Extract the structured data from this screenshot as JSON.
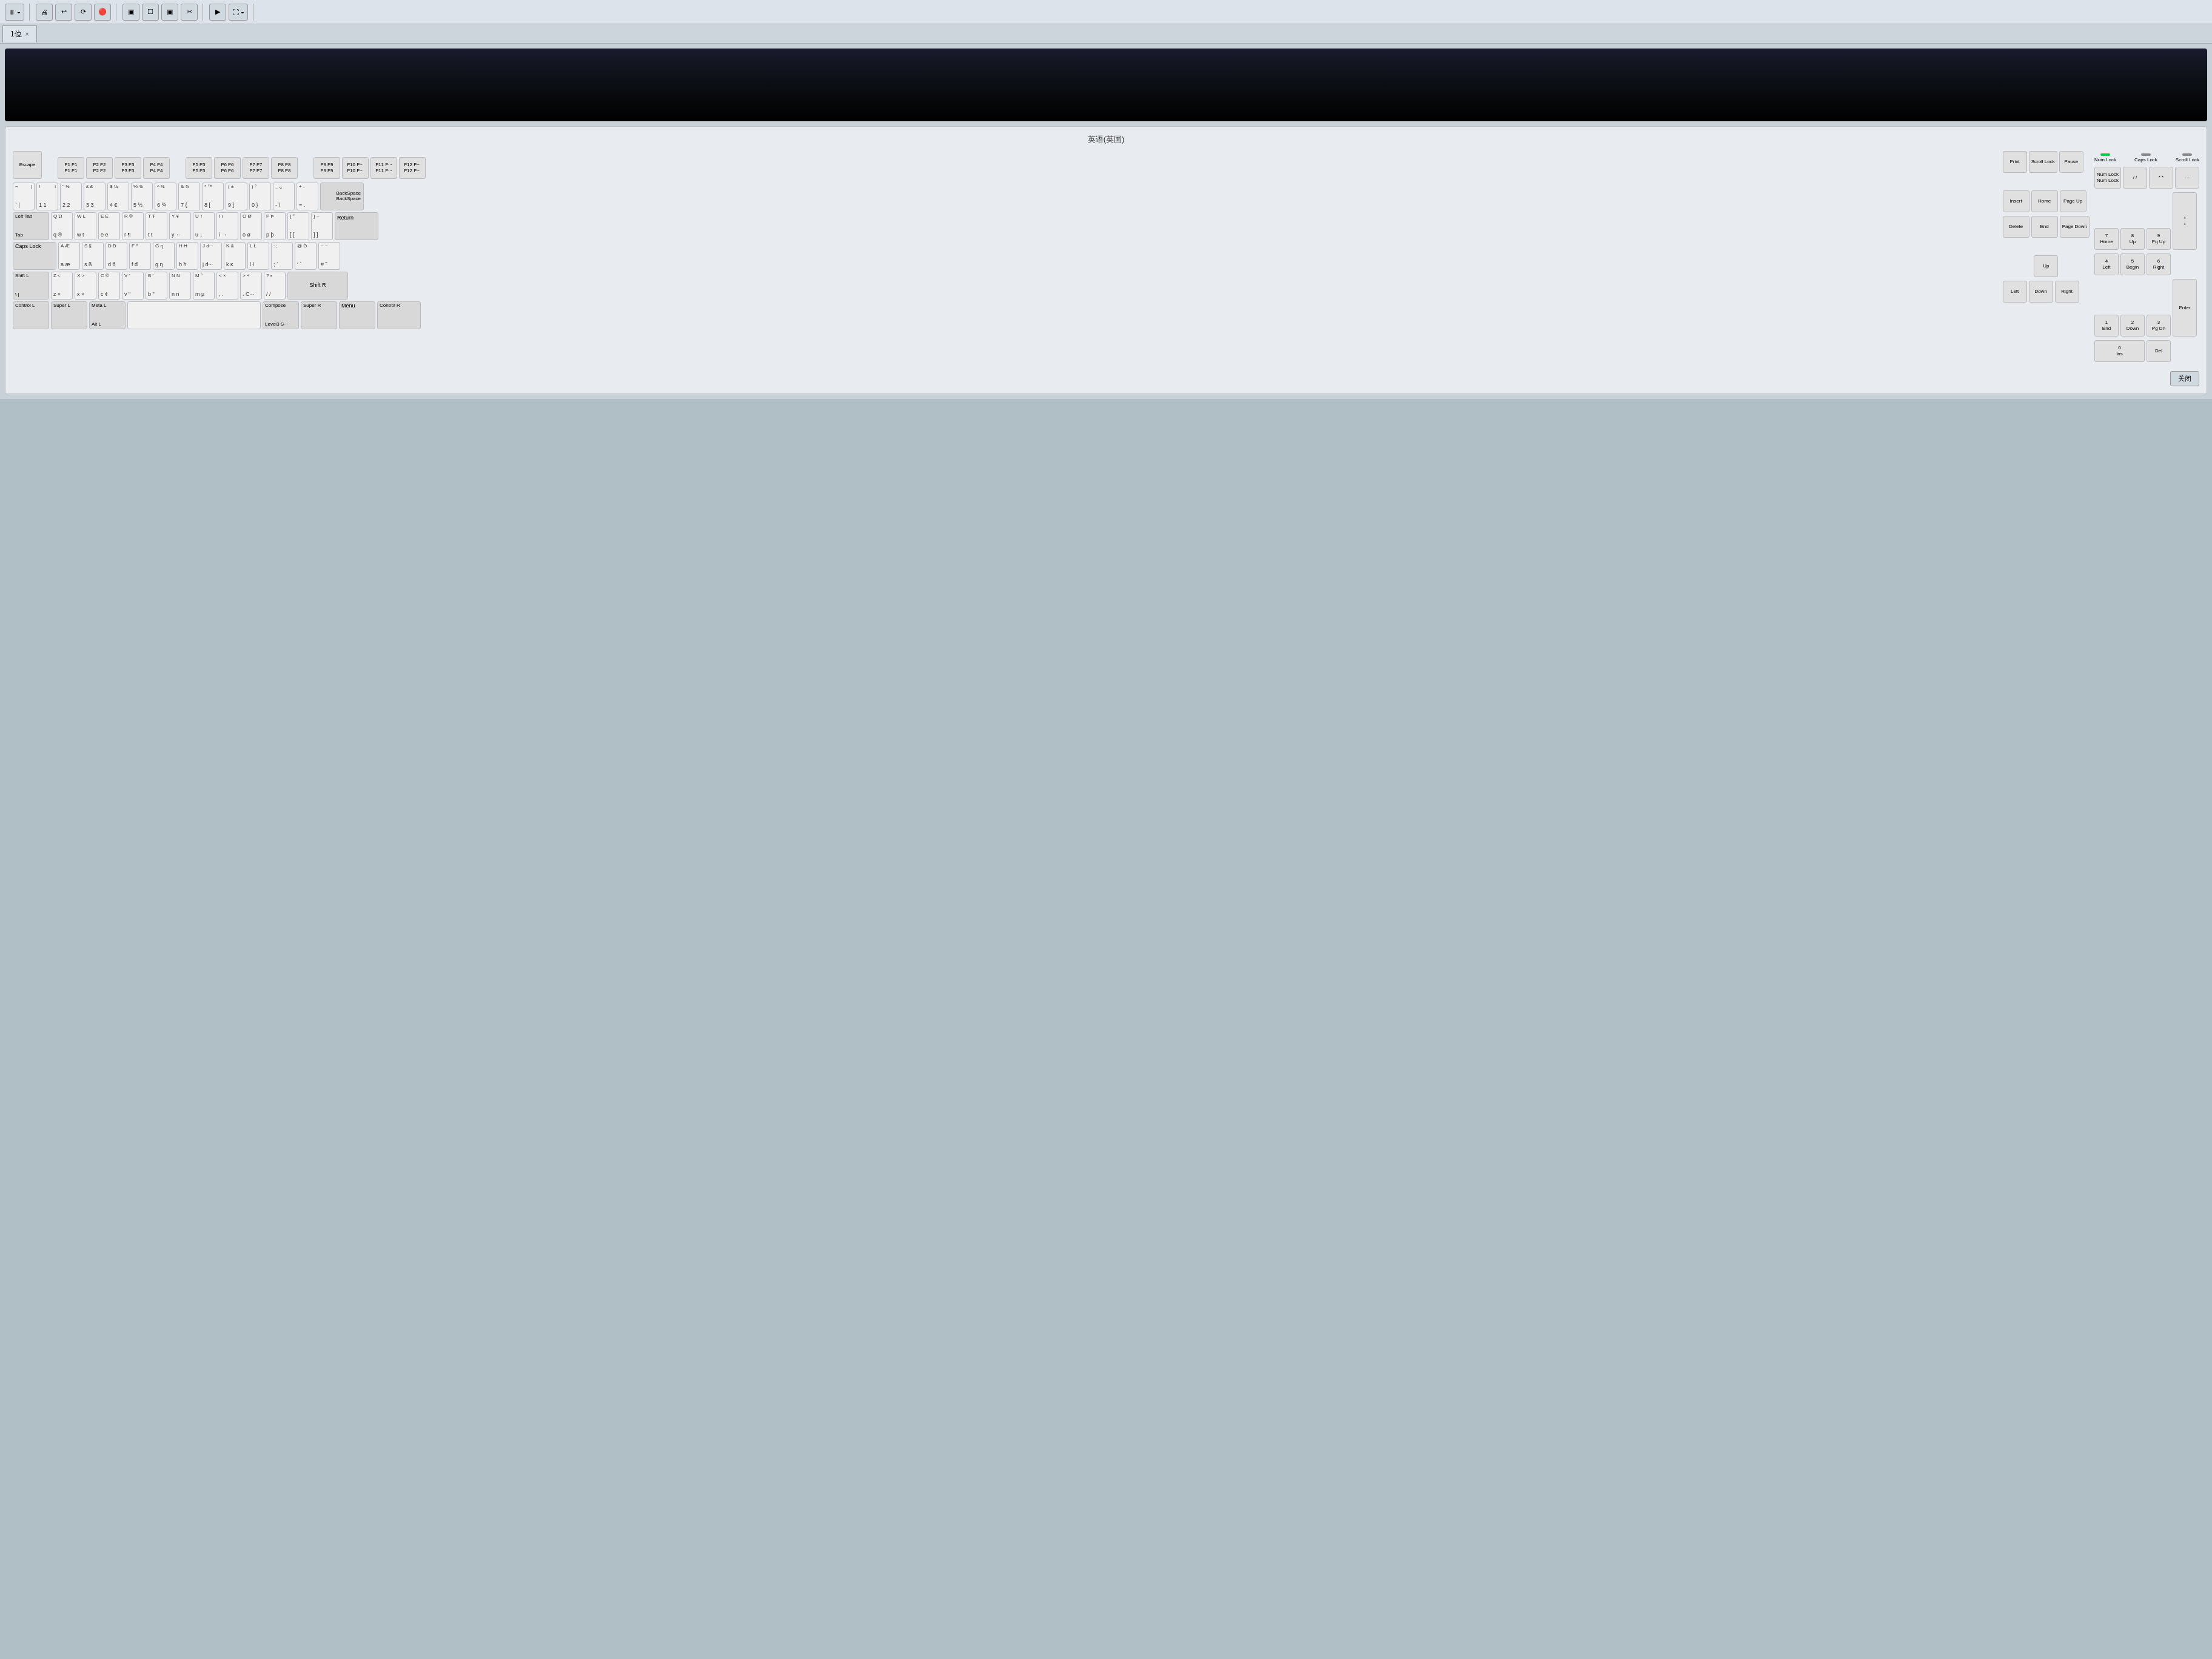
{
  "toolbar": {
    "pause_label": "⏸",
    "buttons": [
      "🖨",
      "↩",
      "⟳",
      "🔴",
      "▣",
      "☐",
      "▣",
      "✂",
      "▶",
      "⛶"
    ]
  },
  "tab": {
    "name": "1位",
    "close": "×"
  },
  "title": "英语(英国)",
  "close_button": "关闭",
  "keys": {
    "escape": "Escape",
    "backspace": "BackSpace",
    "tab_top": "Left Tab",
    "tab_bottom": "Tab",
    "caps": "Caps Lock",
    "shift_l_top": "Shift L",
    "shift_r": "Shift R",
    "ctrl_l_top": "Control L",
    "ctrl_r": "Control R",
    "super_l": "Super L",
    "super_r": "Super R",
    "alt_l": "Alt L",
    "meta_l": "Meta L",
    "compose_top": "Compose",
    "compose_bottom": "Level3 S···",
    "menu": "Menu",
    "return": "Return",
    "print": "Print",
    "scroll_lock": "Scroll Lock",
    "pause": "Pause",
    "insert": "Insert",
    "home": "Home",
    "page_up": "Page Up",
    "delete": "Delete",
    "end": "End",
    "page_down": "Page Down",
    "up": "Up",
    "left": "Left",
    "down": "Down",
    "right": "Right",
    "num_lock_top": "Num Lock",
    "num_lock_bottom": "Num Lock",
    "caps_lock_top": "Caps Lock",
    "scroll_lock2_top": "Scroll Lock"
  }
}
